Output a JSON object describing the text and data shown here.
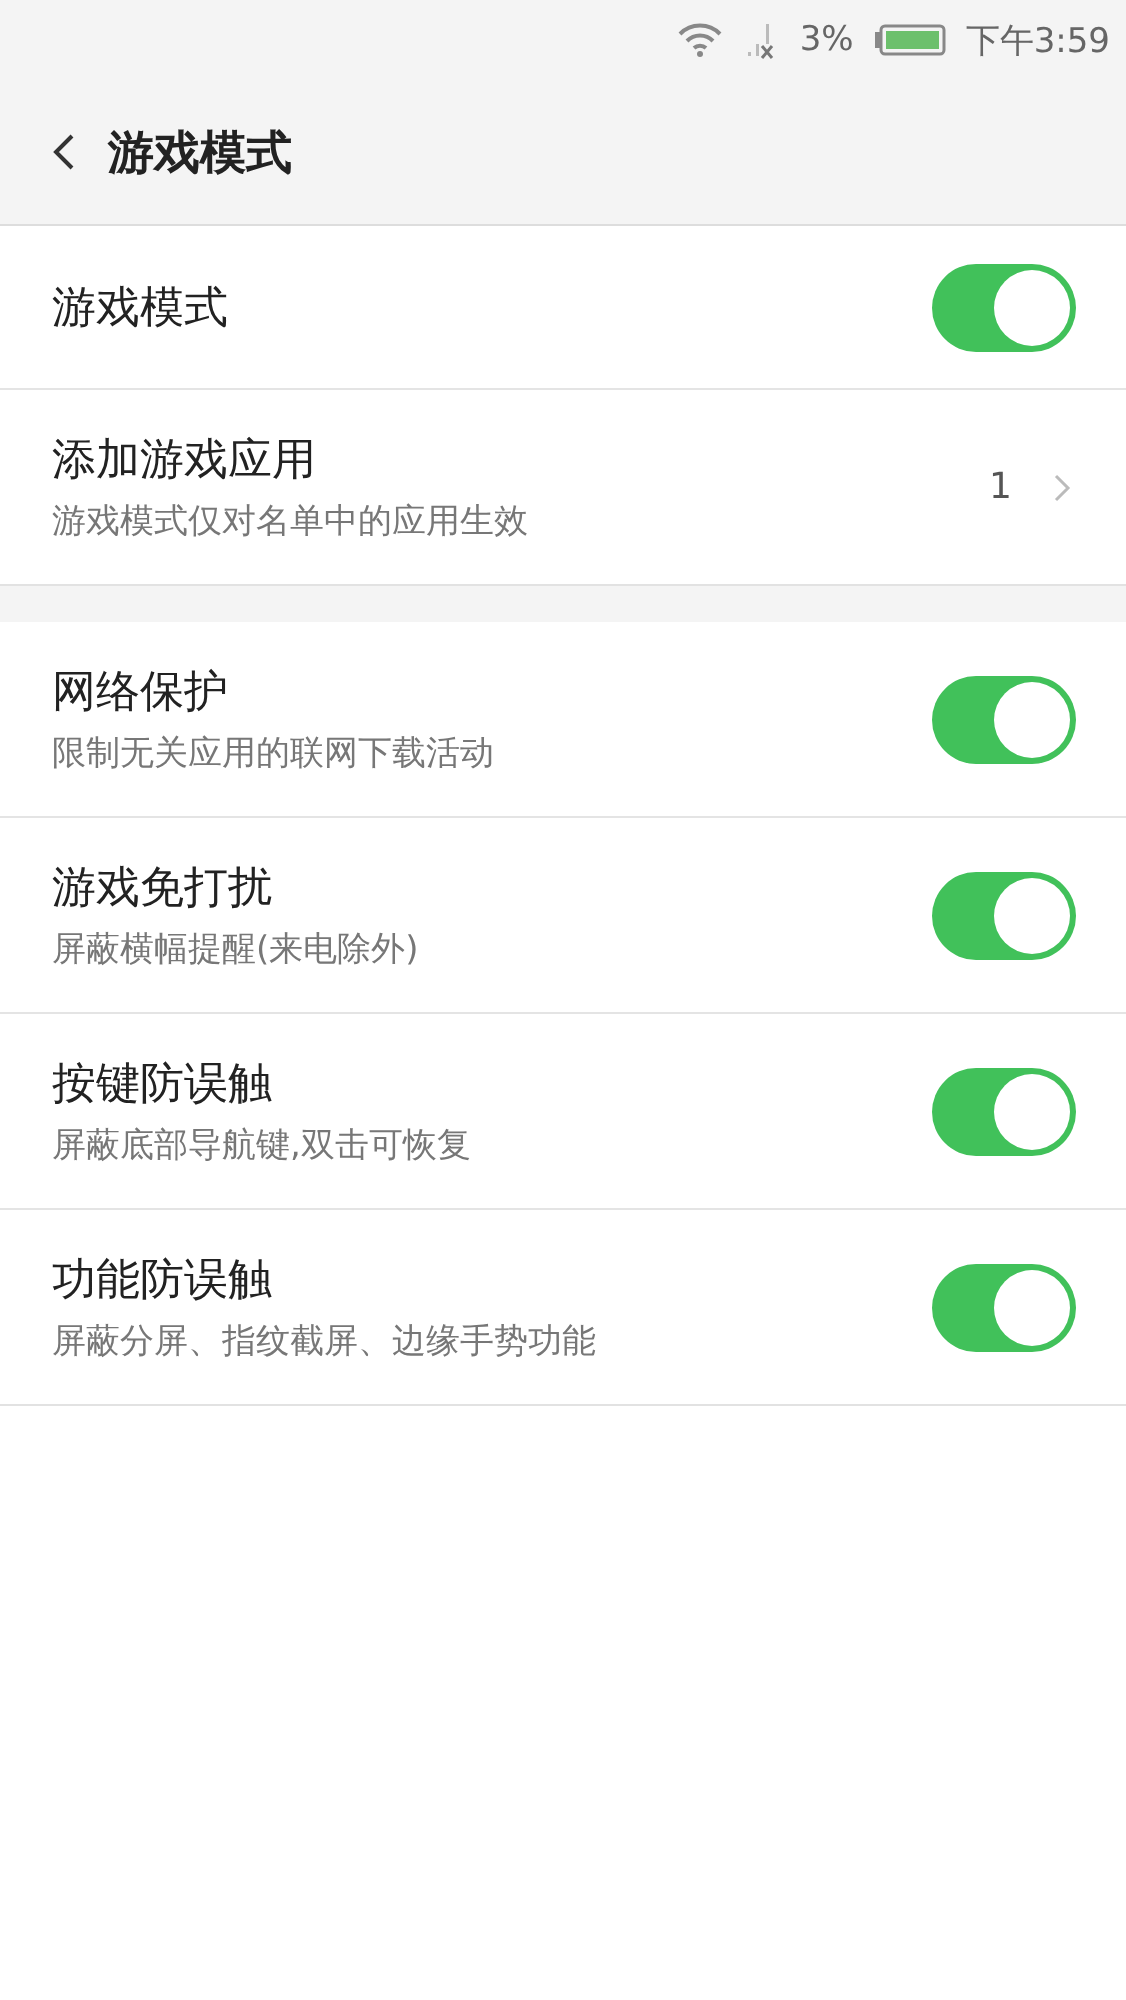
{
  "status_bar": {
    "battery_percent": "3%",
    "time": "下午3:59"
  },
  "header": {
    "title": "游戏模式"
  },
  "sections": [
    {
      "items": [
        {
          "kind": "toggle",
          "title": "游戏模式",
          "on": true
        },
        {
          "kind": "link",
          "title": "添加游戏应用",
          "subtitle": "游戏模式仅对名单中的应用生效",
          "value": "1"
        }
      ]
    },
    {
      "items": [
        {
          "kind": "toggle",
          "title": "网络保护",
          "subtitle": "限制无关应用的联网下载活动",
          "on": true
        },
        {
          "kind": "toggle",
          "title": "游戏免打扰",
          "subtitle": "屏蔽横幅提醒(来电除外)",
          "on": true
        },
        {
          "kind": "toggle",
          "title": "按键防误触",
          "subtitle": "屏蔽底部导航键,双击可恢复",
          "on": true
        },
        {
          "kind": "toggle",
          "title": "功能防误触",
          "subtitle": "屏蔽分屏、指纹截屏、边缘手势功能",
          "on": true
        }
      ]
    }
  ]
}
